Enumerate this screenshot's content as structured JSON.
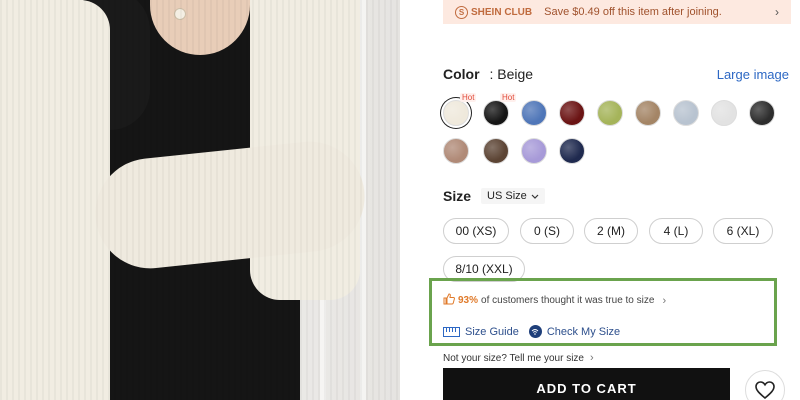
{
  "club_banner": {
    "logo_text": "SHEIN CLUB",
    "message": "Save $0.49 off this item after joining.",
    "arrow": "›"
  },
  "color": {
    "label": "Color",
    "value": ": Beige",
    "large_image_link": "Large image",
    "swatches": [
      {
        "name": "Beige",
        "hex": "#efe9dc",
        "hot": "Hot",
        "selected": true
      },
      {
        "name": "Black",
        "hex": "#151515",
        "hot": "Hot"
      },
      {
        "name": "Blue",
        "hex": "#4f76b8"
      },
      {
        "name": "Burgundy",
        "hex": "#6b1414"
      },
      {
        "name": "Lime",
        "hex": "#a5b45a"
      },
      {
        "name": "Khaki",
        "hex": "#a48566"
      },
      {
        "name": "Baby Blue",
        "hex": "#b8c3d0"
      },
      {
        "name": "White",
        "hex": "#e2e2e2"
      },
      {
        "name": "Dark Grey",
        "hex": "#2d2d2d"
      },
      {
        "name": "Dusty Pink",
        "hex": "#b08a77"
      },
      {
        "name": "Coffee Brown",
        "hex": "#5c4434"
      },
      {
        "name": "Lilac",
        "hex": "#a79ad8"
      },
      {
        "name": "Navy",
        "hex": "#1f2a4f"
      }
    ]
  },
  "size": {
    "label": "Size",
    "unit": "US Size",
    "options": [
      "00 (XS)",
      "0 (S)",
      "2 (M)",
      "4 (L)",
      "6 (XL)",
      "8/10 (XXL)"
    ]
  },
  "fit": {
    "percent": "93%",
    "text": "of customers thought it was true to size",
    "chevron": "›"
  },
  "guide": {
    "size_guide": "Size Guide",
    "check_my_size": "Check My Size"
  },
  "not_size": {
    "text": "Not your size? Tell me your size",
    "chevron": "›"
  },
  "actions": {
    "add_to_cart": "ADD TO CART"
  }
}
